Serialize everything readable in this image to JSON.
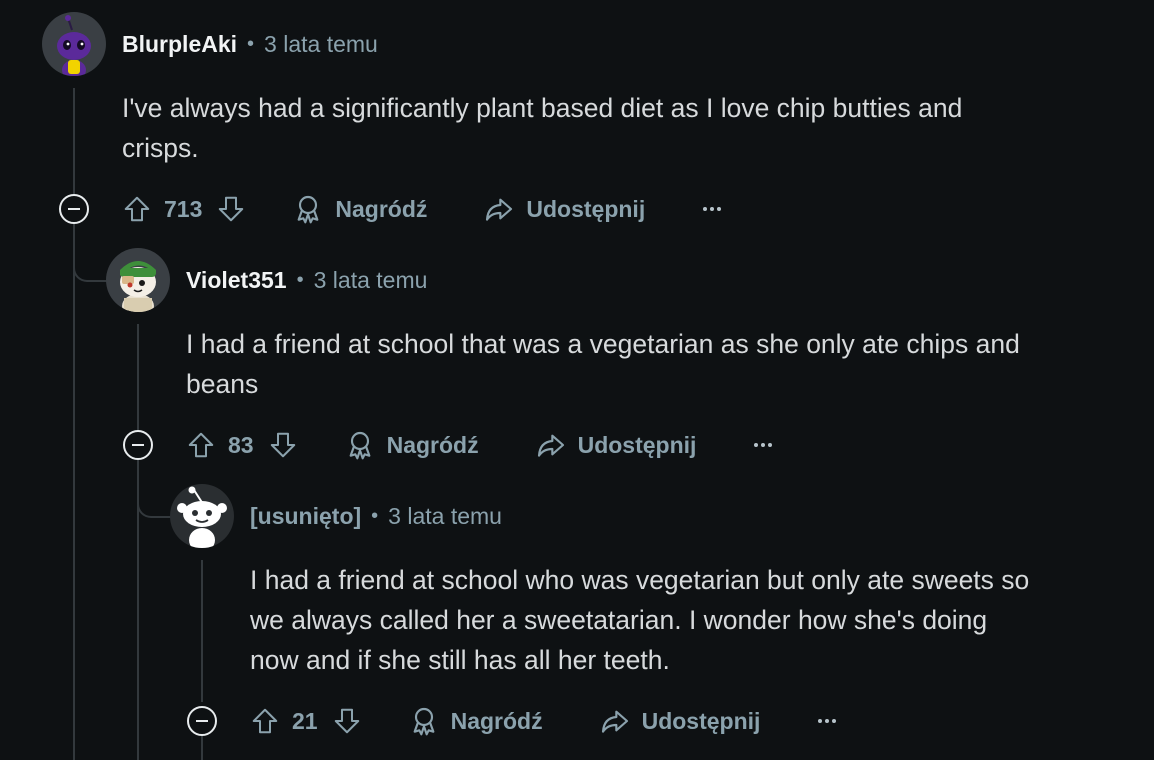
{
  "comments": [
    {
      "author": "BlurpleAki",
      "time": "3 lata temu",
      "body_lines": [
        "I've always had a significantly plant based diet as I love chip butties and",
        "crisps."
      ],
      "votes": "713",
      "award_label": "Nagródź",
      "share_label": "Udostępnij"
    },
    {
      "author": "Violet351",
      "time": "3 lata temu",
      "body_lines": [
        "I had a friend at school that was a vegetarian as she only ate chips and",
        "beans"
      ],
      "votes": "83",
      "award_label": "Nagródź",
      "share_label": "Udostępnij"
    },
    {
      "author": "[usunięto]",
      "time": "3 lata temu",
      "body_lines": [
        "I had a friend at school who was vegetarian but only ate sweets so",
        "we always called her a sweetatarian. I wonder how she's doing",
        "now and if she still has all her teeth."
      ],
      "votes": "21",
      "award_label": "Nagródź",
      "share_label": "Udostępnij"
    }
  ],
  "separator": "•",
  "icons": {
    "upvote": "upvote-arrow-icon",
    "downvote": "downvote-arrow-icon",
    "award": "award-ribbon-icon",
    "share": "share-arrow-icon",
    "more": "more-dots-icon",
    "collapse": "collapse-minus-icon"
  },
  "colors": {
    "background": "#0e1113",
    "muted_text": "#8ba2ad",
    "thread_line": "#33393d"
  }
}
